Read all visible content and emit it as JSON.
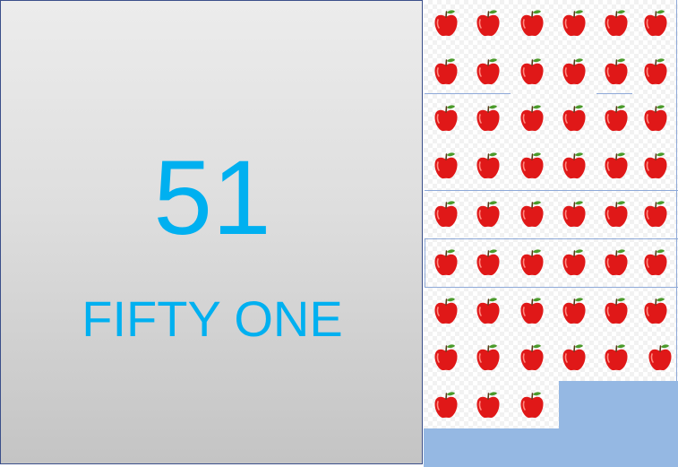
{
  "numeral": "51",
  "word": "FIFTY ONE",
  "apples": {
    "count": 51,
    "icon": "apple-icon",
    "rows": [
      6,
      6,
      6,
      6,
      6,
      6,
      6,
      6,
      3
    ]
  },
  "colors": {
    "number_text": "#00b0f0",
    "apple_red": "#e01818",
    "leaf_green": "#4a9a2a",
    "block_blue": "#95b8e3"
  }
}
